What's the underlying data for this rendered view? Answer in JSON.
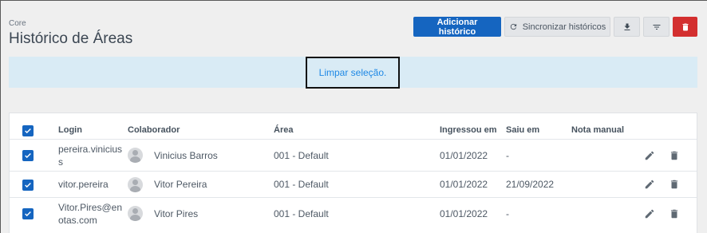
{
  "header": {
    "breadcrumb": "Core",
    "title": "Histórico de Áreas"
  },
  "toolbar": {
    "add_label": "Adicionar histórico",
    "sync_label": "Sincronizar históricos",
    "download_icon": "download-icon",
    "filter_icon": "filter-icon",
    "delete_icon": "trash-icon"
  },
  "banner": {
    "clear_selection_label": "Limpar seleção."
  },
  "table": {
    "columns": [
      "Login",
      "Colaborador",
      "Área",
      "Ingressou em",
      "Saiu em",
      "Nota manual"
    ],
    "rows": [
      {
        "login_line1": "pereira.vinicius",
        "login_line2": "s",
        "collaborator": "Vinicius Barros",
        "area": "001 - Default",
        "joined": "01/01/2022",
        "left": "-",
        "note": "",
        "checked": true
      },
      {
        "login_line1": "vitor.pereira",
        "login_line2": "",
        "collaborator": "Vitor Pereira",
        "area": "001 - Default",
        "joined": "01/01/2022",
        "left": "21/09/2022",
        "note": "",
        "checked": true
      },
      {
        "login_line1": "Vitor.Pires@en",
        "login_line2": "otas.com",
        "collaborator": "Vitor Pires",
        "area": "001 - Default",
        "joined": "01/01/2022",
        "left": "-",
        "note": "",
        "checked": true
      }
    ]
  },
  "colors": {
    "primary": "#1565c0",
    "danger": "#d32f2f",
    "banner_bg": "#d9ebf5",
    "link": "#1e88e5"
  }
}
